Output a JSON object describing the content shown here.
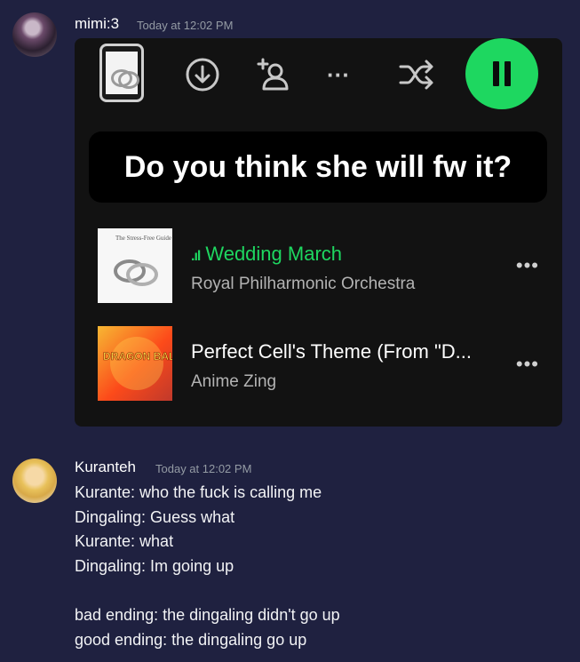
{
  "message1": {
    "username": "mimi:3",
    "timestamp": "Today at 12:02 PM",
    "embed": {
      "controls": [
        "album-thumb",
        "download-icon",
        "add-user-icon",
        "more-icon",
        "shuffle-icon",
        "pause-icon"
      ],
      "more_glyph": "···",
      "caption": "Do you think she will fw it?",
      "tracks": [
        {
          "title": "Wedding March",
          "artist": "Royal Philharmonic Orchestra",
          "playing": true,
          "art_label": "The Stress-Free Guide",
          "more": "•••"
        },
        {
          "title": "Perfect Cell's Theme (From \"D...",
          "artist": "Anime Zing",
          "playing": false,
          "art_label": "DRAGON BALL Z",
          "more": "•••"
        }
      ],
      "accent": "#1ed760"
    }
  },
  "message2": {
    "username": "Kuranteh",
    "timestamp": "Today at 12:02 PM",
    "lines": [
      "Kurante: who the fuck is calling me",
      "Dingaling: Guess what",
      "Kurante: what",
      "Dingaling: Im going up",
      "",
      "bad ending: the dingaling didn't go up",
      "good ending: the dingaling go up"
    ]
  }
}
